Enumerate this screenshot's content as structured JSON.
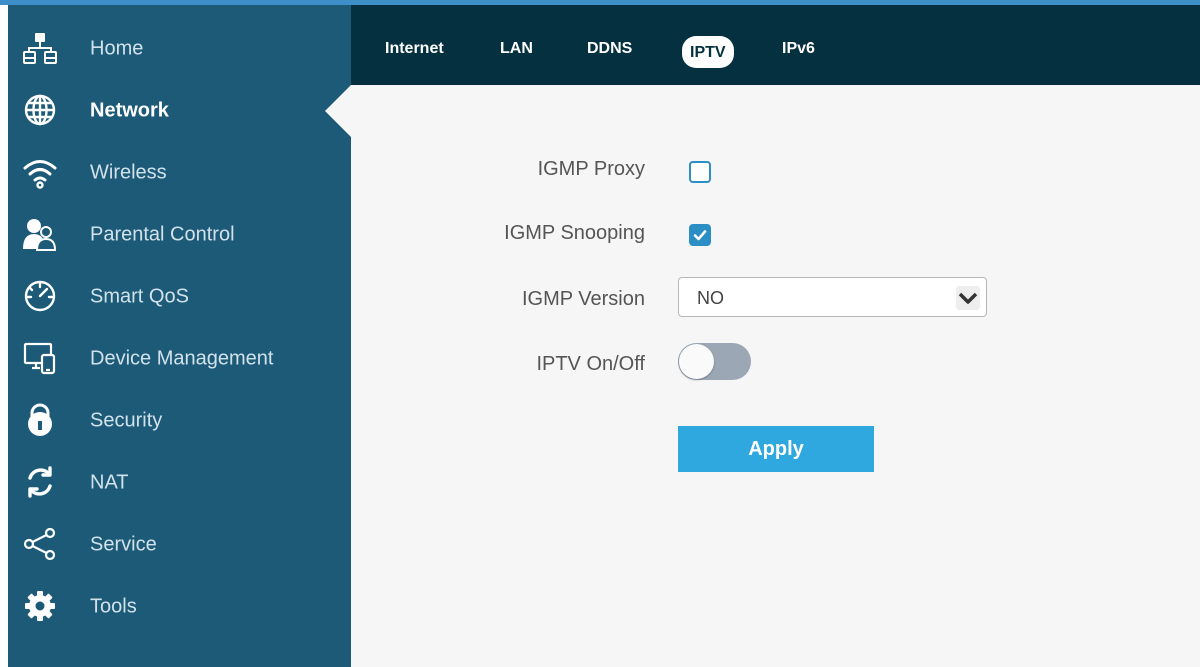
{
  "sidebar": {
    "items": [
      {
        "label": "Home",
        "icon": "network-tree-icon"
      },
      {
        "label": "Network",
        "icon": "globe-icon",
        "active": true
      },
      {
        "label": "Wireless",
        "icon": "wifi-icon"
      },
      {
        "label": "Parental Control",
        "icon": "parental-icon"
      },
      {
        "label": "Smart QoS",
        "icon": "speedometer-icon"
      },
      {
        "label": "Device Management",
        "icon": "devices-icon"
      },
      {
        "label": "Security",
        "icon": "lock-icon"
      },
      {
        "label": "NAT",
        "icon": "refresh-icon"
      },
      {
        "label": "Service",
        "icon": "share-icon"
      },
      {
        "label": "Tools",
        "icon": "gear-icon"
      }
    ]
  },
  "tabs": [
    {
      "label": "Internet"
    },
    {
      "label": "LAN"
    },
    {
      "label": "DDNS"
    },
    {
      "label": "IPTV",
      "active": true
    },
    {
      "label": "IPv6"
    }
  ],
  "form": {
    "igmp_proxy": {
      "label": "IGMP Proxy",
      "checked": false
    },
    "igmp_snooping": {
      "label": "IGMP Snooping",
      "checked": true
    },
    "igmp_version": {
      "label": "IGMP Version",
      "value": "NO"
    },
    "iptv_toggle": {
      "label": "IPTV On/Off",
      "on": false
    },
    "apply_label": "Apply"
  },
  "colors": {
    "sidebar_bg": "#1c5a78",
    "tabbar_bg": "#05303f",
    "accent": "#2fa8df",
    "checkbox": "#2b8ec4"
  }
}
